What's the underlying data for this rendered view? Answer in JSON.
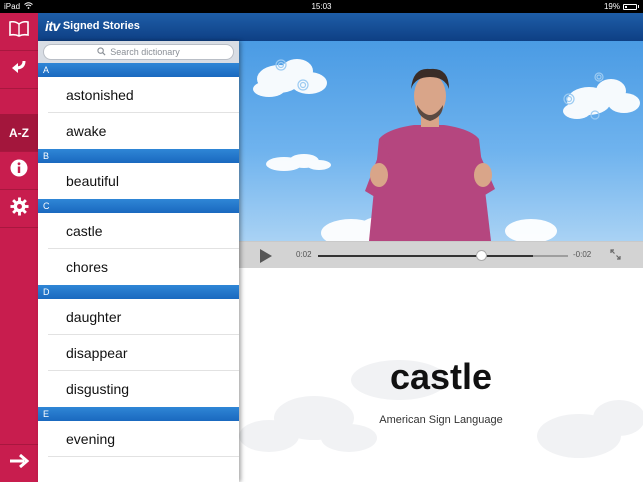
{
  "status": {
    "device": "iPad",
    "time": "15:03",
    "battery": "19%"
  },
  "app": {
    "logo": "itv",
    "title": "Signed Stories"
  },
  "rail": {
    "items": [
      {
        "name": "book-icon"
      },
      {
        "name": "back-arrow-icon"
      },
      {
        "name": "az",
        "label": "A-Z"
      },
      {
        "name": "info-icon"
      },
      {
        "name": "gear-icon"
      }
    ],
    "bottom": {
      "name": "arrow-right-icon"
    }
  },
  "dictionary": {
    "search_placeholder": "Search dictionary",
    "sections": [
      {
        "letter": "A",
        "words": [
          "astonished",
          "awake"
        ]
      },
      {
        "letter": "B",
        "words": [
          "beautiful"
        ]
      },
      {
        "letter": "C",
        "words": [
          "castle",
          "chores"
        ]
      },
      {
        "letter": "D",
        "words": [
          "daughter",
          "disappear",
          "disgusting"
        ]
      },
      {
        "letter": "E",
        "words": [
          "evening"
        ]
      }
    ]
  },
  "player": {
    "current_time": "0:02",
    "remaining_time": "-0:02",
    "progress": 0.65,
    "buffered": 0.86
  },
  "selected": {
    "word": "castle",
    "language": "American Sign Language"
  },
  "colors": {
    "rail": "#c81d4e",
    "header": "#1557a0",
    "section": "#2279cc",
    "sky": "#5fa8ea"
  }
}
